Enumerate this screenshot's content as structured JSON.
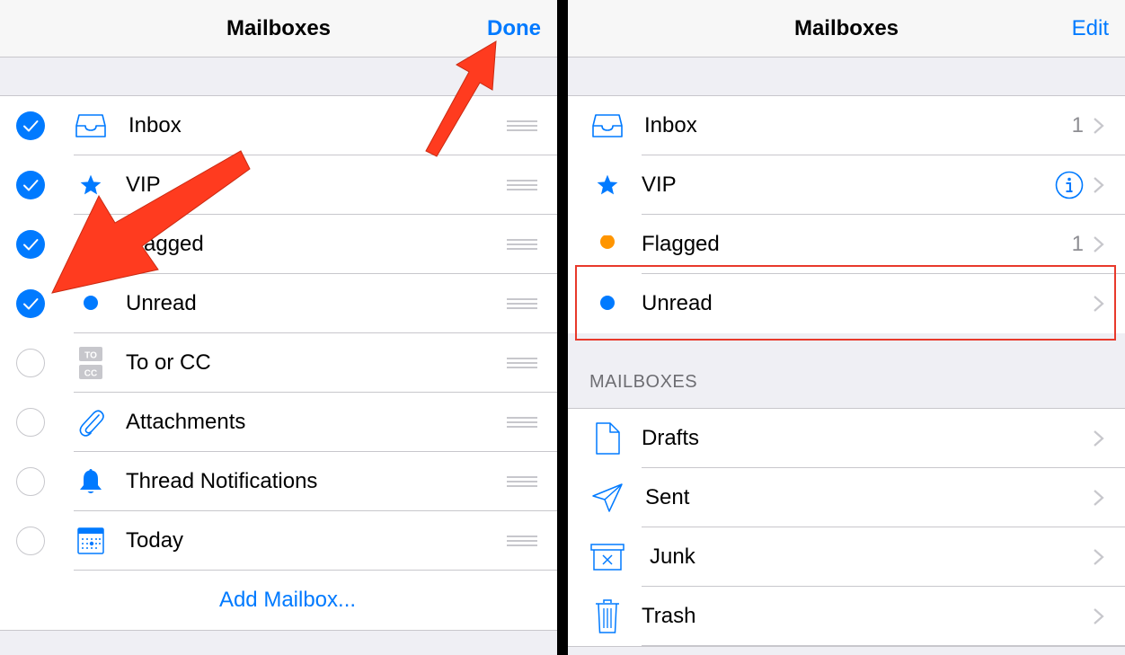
{
  "left": {
    "title": "Mailboxes",
    "done_label": "Done",
    "items": [
      {
        "label": "Inbox",
        "checked": true,
        "icon": "inbox-icon"
      },
      {
        "label": "VIP",
        "checked": true,
        "icon": "star-icon"
      },
      {
        "label": "Flagged",
        "checked": true,
        "icon": "flag-icon"
      },
      {
        "label": "Unread",
        "checked": true,
        "icon": "dot-icon"
      },
      {
        "label": "To or CC",
        "checked": false,
        "icon": "to-cc-icon"
      },
      {
        "label": "Attachments",
        "checked": false,
        "icon": "paperclip-icon"
      },
      {
        "label": "Thread Notifications",
        "checked": false,
        "icon": "bell-icon"
      },
      {
        "label": "Today",
        "checked": false,
        "icon": "calendar-icon"
      }
    ],
    "add_label": "Add Mailbox..."
  },
  "right": {
    "title": "Mailboxes",
    "edit_label": "Edit",
    "smart": [
      {
        "label": "Inbox",
        "count": "1",
        "icon": "inbox-icon"
      },
      {
        "label": "VIP",
        "count": "",
        "icon": "star-icon",
        "info": true
      },
      {
        "label": "Flagged",
        "count": "1",
        "icon": "orange-dot-icon"
      },
      {
        "label": "Unread",
        "count": "",
        "icon": "blue-dot-icon"
      }
    ],
    "section_header": "MAILBOXES",
    "mailboxes": [
      {
        "label": "Drafts",
        "icon": "document-icon"
      },
      {
        "label": "Sent",
        "icon": "paper-plane-icon"
      },
      {
        "label": "Junk",
        "icon": "junk-bin-icon"
      },
      {
        "label": "Trash",
        "icon": "trash-icon"
      }
    ]
  },
  "colors": {
    "accent": "#007aff",
    "flag_orange": "#ff9500",
    "annotation_red": "#e8392b"
  }
}
